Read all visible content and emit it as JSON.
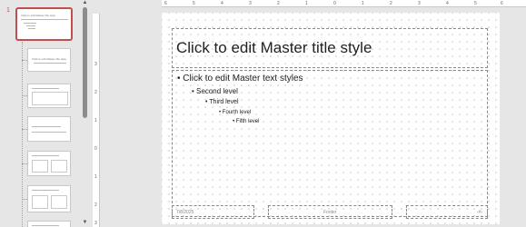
{
  "thumbnail_panel": {
    "first_slide_number": "1",
    "master_thumb_title": "Click to edit Master title style",
    "layout_thumb_title": "Click to edit Master title style"
  },
  "slide": {
    "title": "Click to edit Master title style",
    "levels": [
      "Click to edit Master text styles",
      "Second level",
      "Third level",
      "Fourth level",
      "Fifth level"
    ],
    "footer": {
      "date": "7/8/2025",
      "center": "Footer",
      "slide_number": "‹#›"
    }
  },
  "rulers": {
    "top": [
      "6",
      "5",
      "4",
      "3",
      "2",
      "1",
      "0",
      "1",
      "2",
      "3",
      "4",
      "5",
      "6"
    ],
    "left": [
      "3",
      "2",
      "1",
      "0",
      "1",
      "2",
      "3"
    ]
  },
  "colors": {
    "accent": "#c0504d",
    "panel_bg": "#e6e6e6"
  }
}
